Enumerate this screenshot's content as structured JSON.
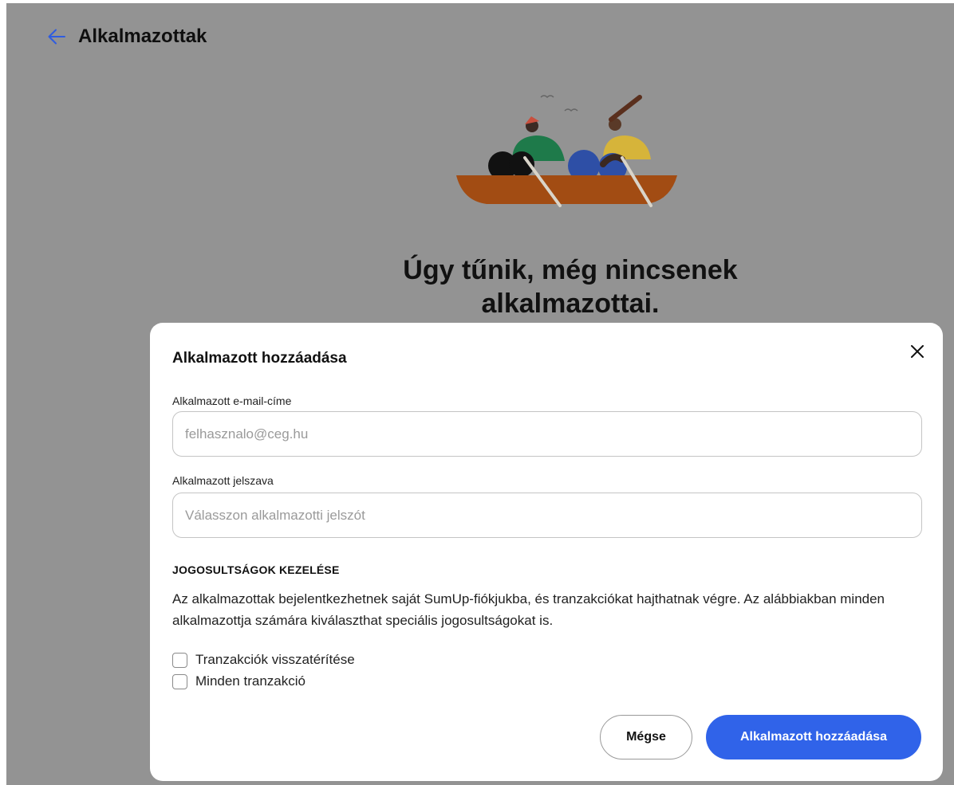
{
  "page": {
    "title": "Alkalmazottak",
    "back_icon": "arrow-left-icon",
    "empty_state_title": "Úgy tűnik, még nincsenek alkalmazottai.",
    "empty_state_illustration": "two-people-rowing-boat"
  },
  "modal": {
    "title": "Alkalmazott hozzáadása",
    "close_icon": "close-icon",
    "email": {
      "label": "Alkalmazott e-mail-címe",
      "value": "",
      "placeholder": "felhasznalo@ceg.hu"
    },
    "password": {
      "label": "Alkalmazott jelszava",
      "value": "",
      "placeholder": "Válasszon alkalmazotti jelszót"
    },
    "permissions": {
      "heading": "JOGOSULTSÁGOK KEZELÉSE",
      "description": "Az alkalmazottak bejelentkezhetnek saját SumUp-fiókjukba, és tranzakciókat hajthatnak végre. Az alábbiakban minden alkalmazottja számára kiválaszthat speciális jogosultságokat is.",
      "options": [
        {
          "label": "Tranzakciók visszatérítése",
          "checked": false
        },
        {
          "label": "Minden tranzakció",
          "checked": false
        }
      ]
    },
    "cancel_label": "Mégse",
    "submit_label": "Alkalmazott hozzáadása"
  },
  "colors": {
    "overlay": "#939393",
    "primary_button": "#3063e9",
    "back_arrow": "#2f5ce0"
  }
}
